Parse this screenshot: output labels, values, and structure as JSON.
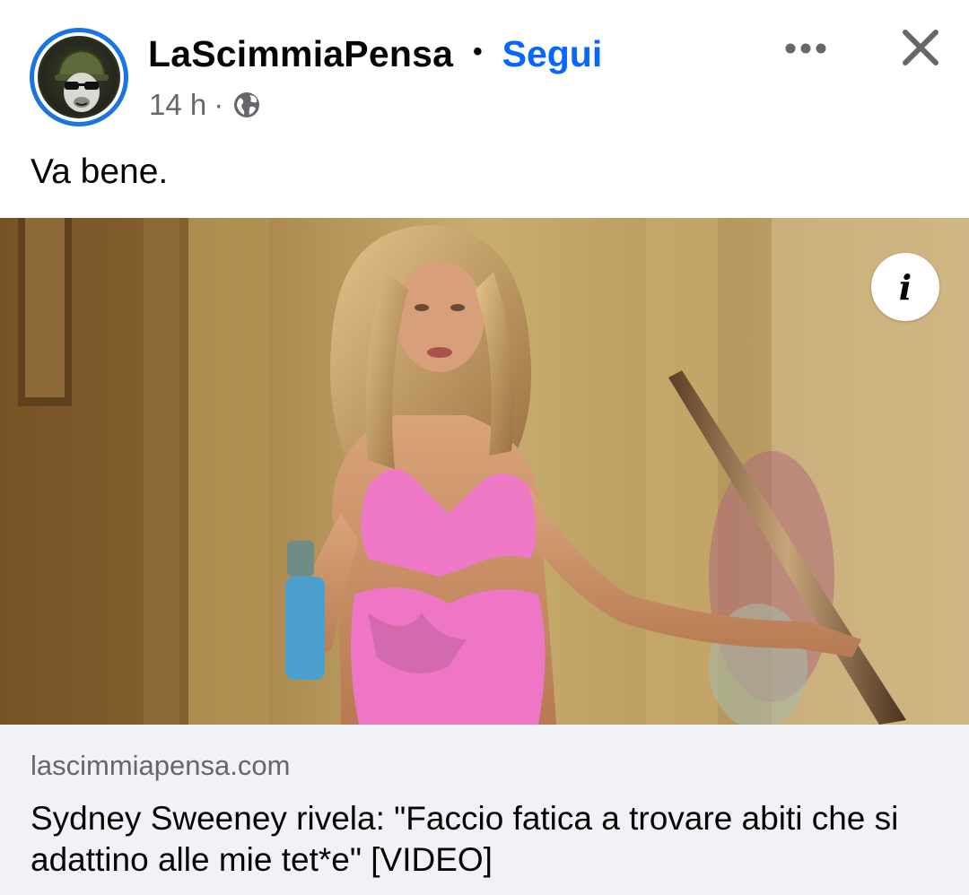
{
  "post": {
    "author": "LaScimmiaPensa",
    "separator": "•",
    "follow_label": "Segui",
    "time": "14 h",
    "meta_separator": "·",
    "caption": "Va bene."
  },
  "icons": {
    "more": "more-dots-icon",
    "close": "close-icon",
    "audience": "globe-icon",
    "info": "info-icon",
    "avatar": "monkey-helmet-logo"
  },
  "media": {
    "info_glyph": "i"
  },
  "link_preview": {
    "domain": "lascimmiapensa.com",
    "title": "Sydney Sweeney rivela: \"Faccio fatica a trovare abiti che si adattino alle mie tet*e\" [VIDEO]"
  },
  "colors": {
    "accent": "#0866ff",
    "avatar_ring": "#1b74e4",
    "secondary_text": "#65676b",
    "link_background": "#f0f2f5"
  }
}
